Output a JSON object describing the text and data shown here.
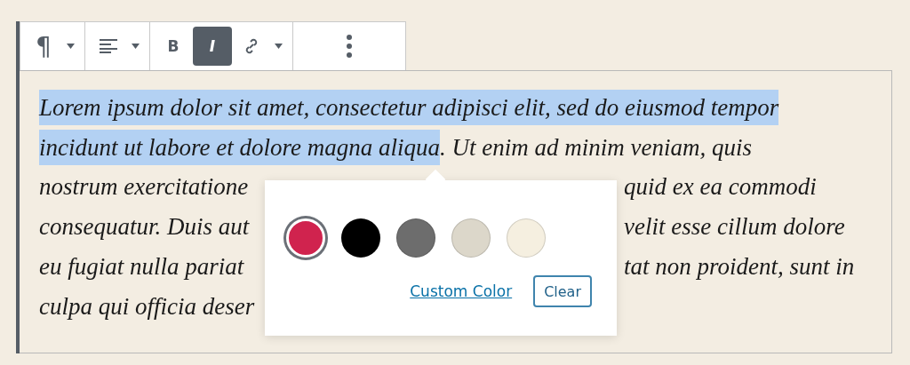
{
  "toolbar": {
    "groups": [
      {
        "items": [
          {
            "kind": "glyph",
            "label": "¶"
          },
          {
            "kind": "caret"
          }
        ]
      },
      {
        "items": [
          {
            "kind": "align"
          },
          {
            "kind": "caret"
          }
        ]
      },
      {
        "items": [
          {
            "kind": "bold",
            "label": "B",
            "active": false
          },
          {
            "kind": "italic",
            "label": "I",
            "active": true
          },
          {
            "kind": "link"
          },
          {
            "kind": "caret"
          }
        ]
      },
      {
        "items": [
          {
            "kind": "more"
          }
        ]
      }
    ]
  },
  "paragraph": {
    "lines": [
      {
        "segments": [
          {
            "text": "Lorem ipsum dolor sit amet, consectetur adipisci elit, sed do eiusmod tempor",
            "selected": true
          }
        ]
      },
      {
        "segments": [
          {
            "text": "incidunt ut labore et dolore magna aliqua",
            "selected": true
          },
          {
            "text": ". Ut enim ad minim veniam, quis",
            "selected": false
          }
        ]
      },
      {
        "left": "nostrum exercitatione",
        "right": "quid ex ea commodi"
      },
      {
        "left": "consequatur. Duis aut",
        "right": "velit esse cillum dolore"
      },
      {
        "left": "eu fugiat nulla pariat",
        "right": "tat non proident, sunt in"
      },
      {
        "left": "culpa qui officia deser"
      }
    ]
  },
  "color_popover": {
    "swatches": [
      {
        "color": "#d0234e",
        "selected": true
      },
      {
        "color": "#000000",
        "selected": false
      },
      {
        "color": "#6d6d6d",
        "selected": false
      },
      {
        "color": "#dcd7ca",
        "selected": false
      },
      {
        "color": "#f5efe0",
        "selected": false
      }
    ],
    "custom_color_link": "Custom Color",
    "clear_button": "Clear"
  }
}
